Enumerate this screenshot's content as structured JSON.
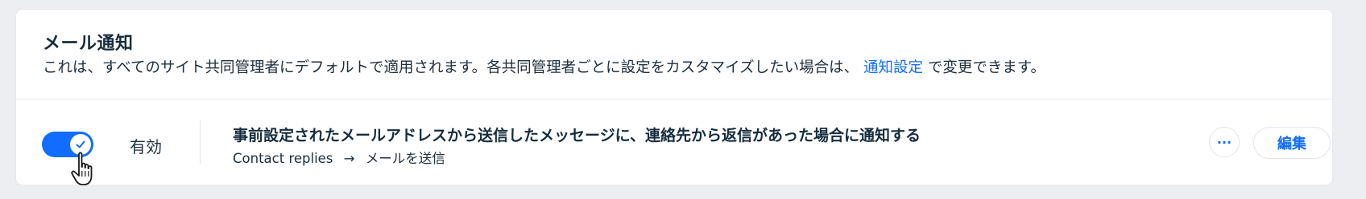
{
  "section": {
    "title": "メール通知",
    "description_before_link": "これは、すべてのサイト共同管理者にデフォルトで適用されます。各共同管理者ごとに設定をカスタマイズしたい場合は、",
    "link_text": "通知設定",
    "description_after_link": "で変更できます。"
  },
  "notification": {
    "enabled": true,
    "status_label": "有効",
    "title": "事前設定されたメールアドレスから送信したメッセージに、連絡先から返信があった場合に通知する",
    "trigger": "Contact replies",
    "arrow": "→",
    "action": "メールを送信",
    "more_label": "···",
    "edit_label": "編集"
  },
  "colors": {
    "accent": "#116dff",
    "background": "#eceef1",
    "card": "#ffffff",
    "text": "#20303c"
  },
  "icons": {
    "toggle_check": "check-icon",
    "cursor": "hand-pointer-icon",
    "more": "more-icon"
  }
}
